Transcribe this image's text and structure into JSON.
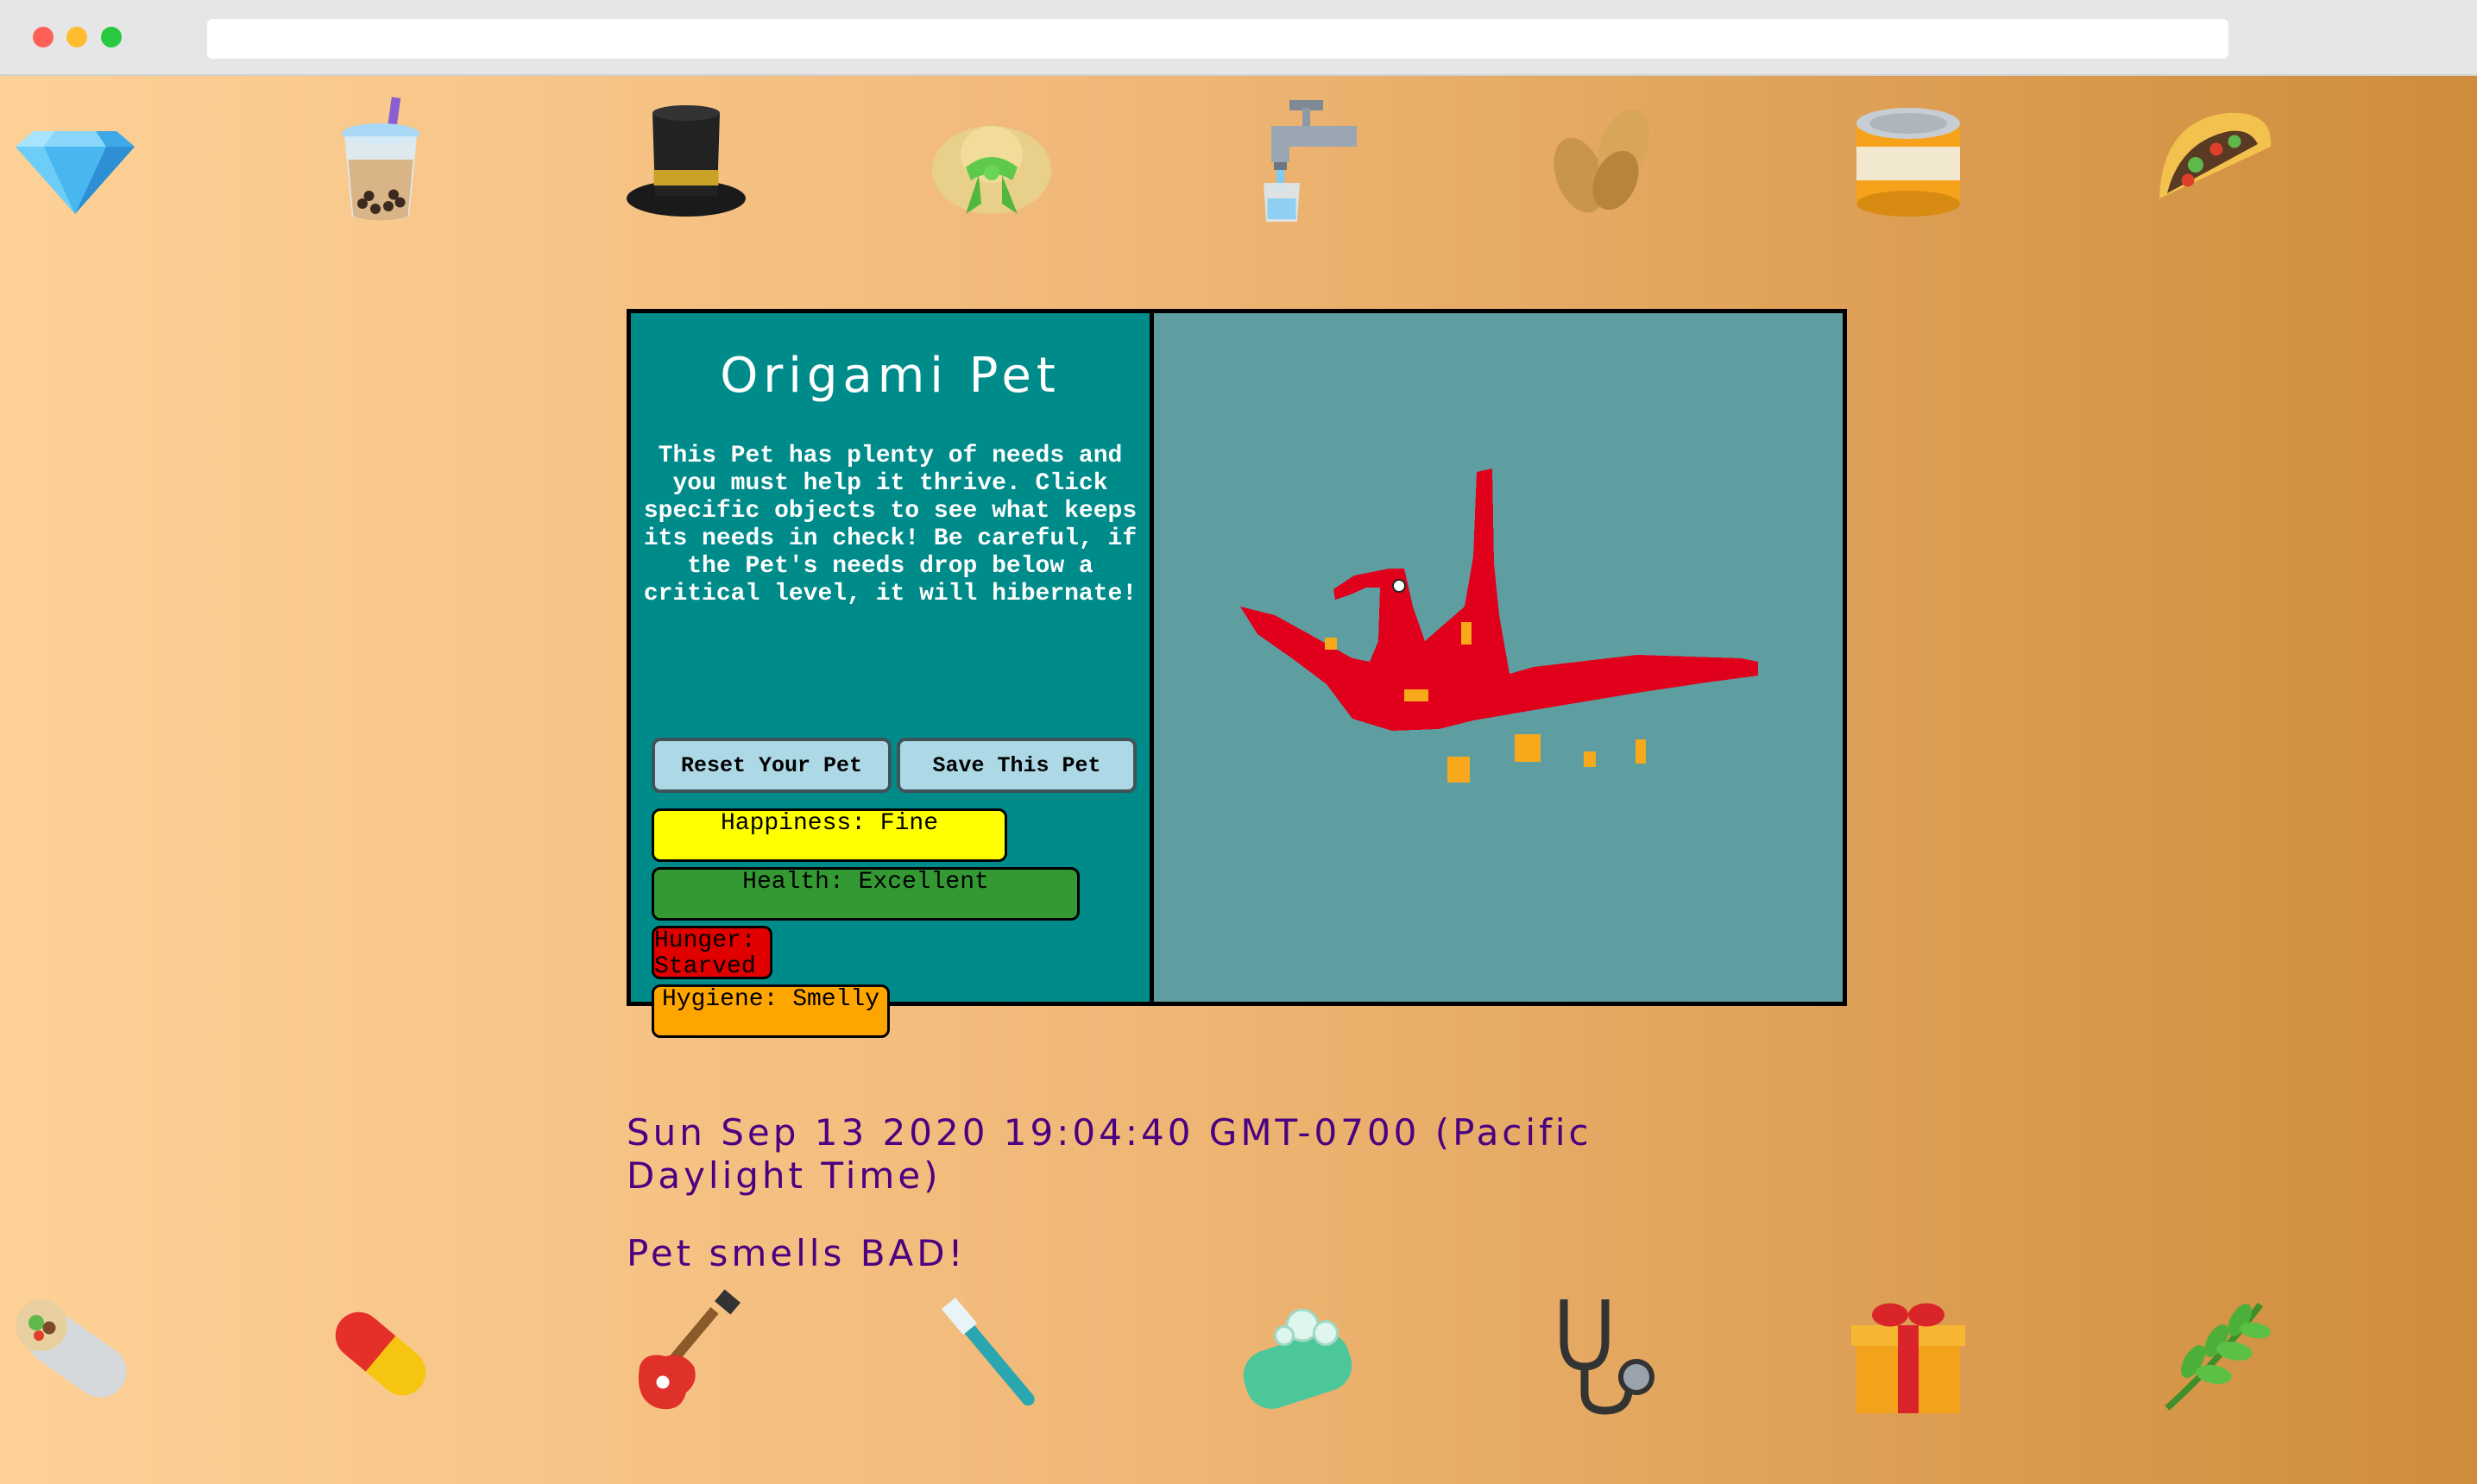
{
  "browser": {
    "address": ""
  },
  "top_items": [
    {
      "icon": "diamond-icon"
    },
    {
      "icon": "bubble-tea-icon"
    },
    {
      "icon": "top-hat-icon"
    },
    {
      "icon": "sun-hat-icon"
    },
    {
      "icon": "water-faucet-icon"
    },
    {
      "icon": "peanuts-icon"
    },
    {
      "icon": "canned-food-icon"
    },
    {
      "icon": "taco-icon"
    }
  ],
  "bottom_items": [
    {
      "icon": "burrito-icon"
    },
    {
      "icon": "pill-icon"
    },
    {
      "icon": "guitar-icon"
    },
    {
      "icon": "toothbrush-icon"
    },
    {
      "icon": "soap-icon"
    },
    {
      "icon": "stethoscope-icon"
    },
    {
      "icon": "gift-icon"
    },
    {
      "icon": "herb-icon"
    }
  ],
  "pet": {
    "title": "Origami Pet",
    "description": "This Pet has plenty of needs and you must help it thrive. Click specific objects to see what keeps its needs in check! Be careful, if the Pet's needs drop below a critical level, it will hibernate!",
    "reset_label": "Reset Your Pet",
    "save_label": "Save This Pet",
    "stats": {
      "happiness": "Happiness: Fine",
      "health": "Health: Excellent",
      "hunger": "Hunger: Starved",
      "hygiene": "Hygiene: Smelly"
    },
    "colors": {
      "panel": "#008b8b",
      "stage": "#5f9ea0",
      "crane": "#e0001b",
      "happiness": "#ffff00",
      "health": "#339933",
      "hunger": "#e00000",
      "hygiene": "#ffa500"
    }
  },
  "datetime": "Sun Sep 13 2020 19:04:40 GMT-0700 (Pacific Daylight Time)",
  "message": "Pet smells BAD!"
}
